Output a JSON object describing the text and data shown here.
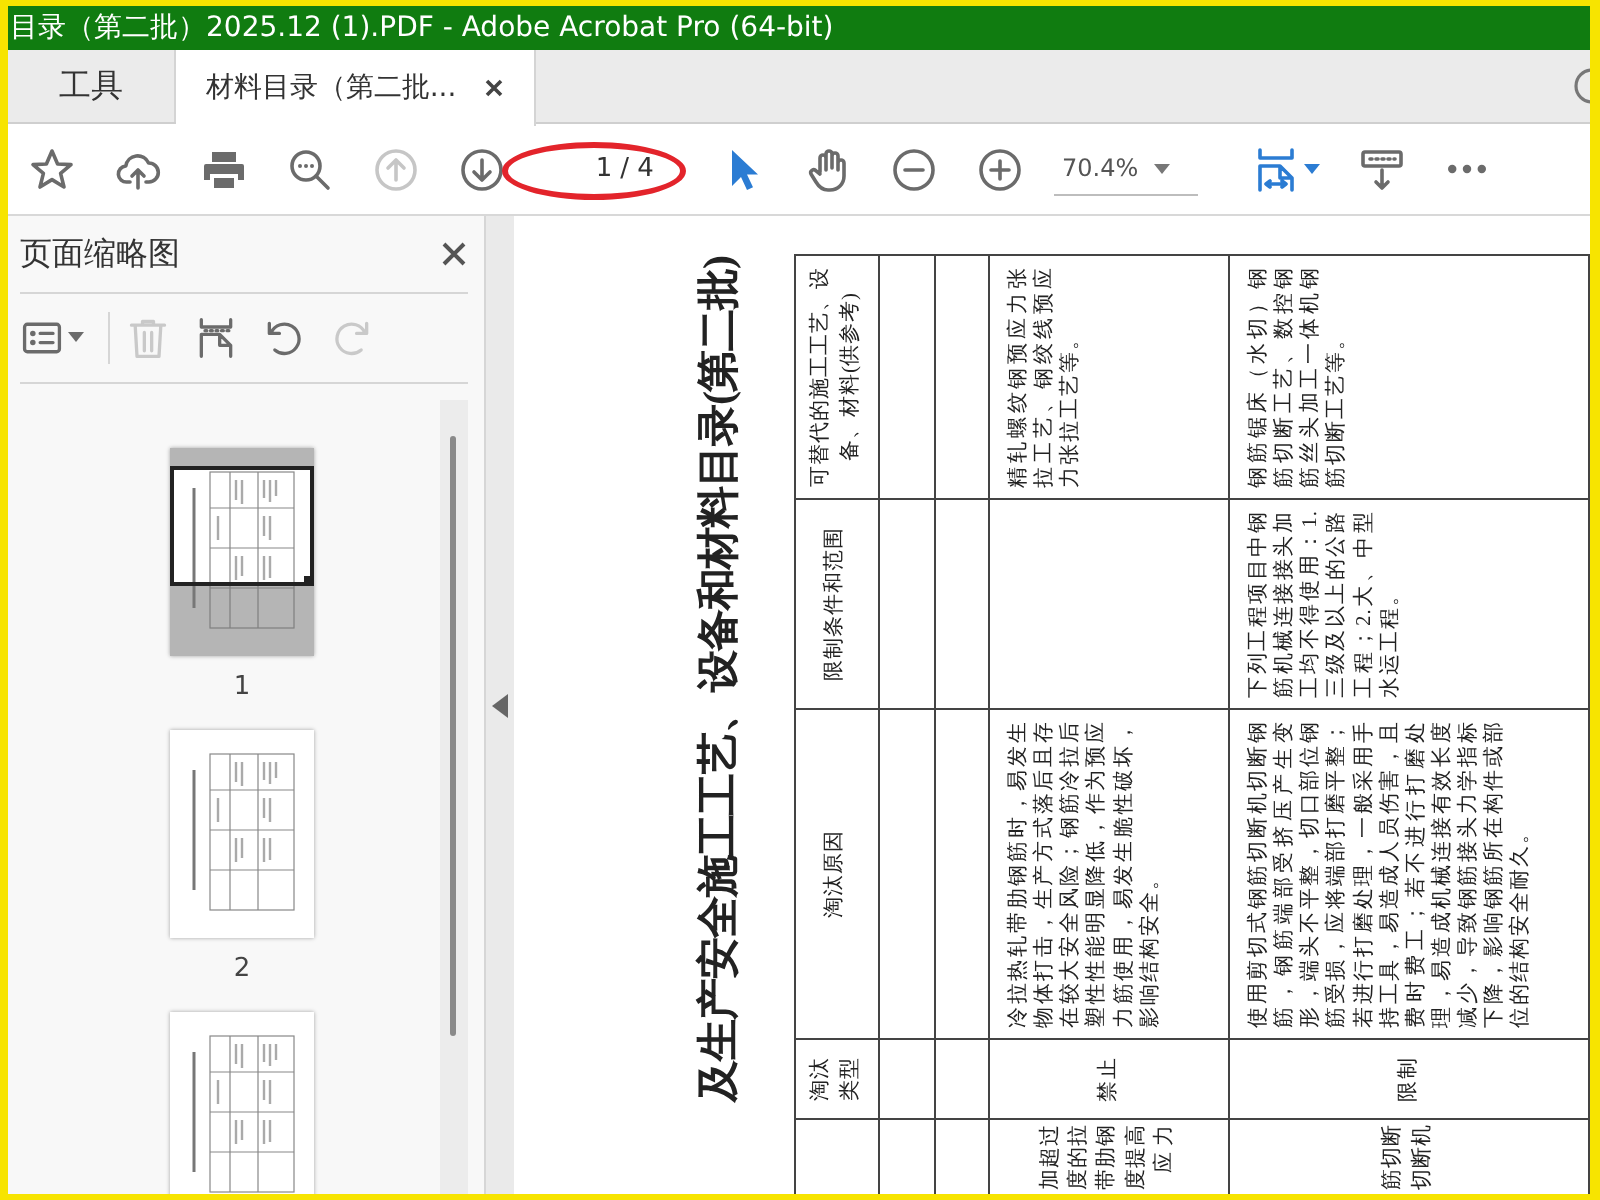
{
  "window": {
    "title": "目录（第二批）2025.12 (1).PDF - Adobe Acrobat Pro (64-bit)"
  },
  "tabs": [
    {
      "label": "工具",
      "kind": "home",
      "selected": false
    },
    {
      "label": "材料目录（第二批...",
      "kind": "document",
      "selected": true
    }
  ],
  "toolbar": [
    {
      "kind": "star",
      "disabled": false
    },
    {
      "kind": "upload",
      "disabled": false
    },
    {
      "kind": "print",
      "disabled": false
    },
    {
      "kind": "find",
      "disabled": false
    },
    {
      "kind": "prev_page",
      "disabled": true
    },
    {
      "kind": "next_page",
      "disabled": false
    },
    {
      "kind": "page_field",
      "value": "1",
      "total": "/ 4"
    },
    {
      "kind": "select",
      "disabled": false,
      "selected": true
    },
    {
      "kind": "hand",
      "disabled": false,
      "selected": false
    },
    {
      "kind": "zoom_out",
      "disabled": false
    },
    {
      "kind": "zoom_in",
      "disabled": false
    },
    {
      "kind": "zoom_field",
      "value": "70.4%"
    },
    {
      "kind": "fit",
      "disabled": false
    },
    {
      "kind": "read_mode",
      "disabled": false
    },
    {
      "kind": "more",
      "disabled": false
    }
  ],
  "thumbnail_panel": {
    "title": "页面缩略图",
    "tools": [
      {
        "kind": "options",
        "disabled": false
      },
      {
        "kind": "delete",
        "disabled": true
      },
      {
        "kind": "extract",
        "disabled": false
      },
      {
        "kind": "rotate_left",
        "disabled": false
      },
      {
        "kind": "rotate_right",
        "disabled": true
      }
    ],
    "pages": [
      {
        "label": "1",
        "selected": true
      },
      {
        "label": "2",
        "selected": false
      },
      {
        "selected": false
      }
    ]
  },
  "document": {
    "title": "及生产安全施工工艺、设备和材料目录(第二批)",
    "table": {
      "columns": {
        "type": "淘汰类型",
        "reason": "淘汰原因",
        "limits": "限制条件和范围",
        "alternative": "可替代的施工工艺、设备、材料(供参考)"
      },
      "rows": [
        {
          "column_1": [
            "加超过",
            "度的拉",
            "带肋钢",
            "度提高",
            "应 力"
          ],
          "type": "禁止",
          "reason": "冷拉热轧带肋钢筋时，易发生物体打击，生产方式落后且存在较大安全风险；钢筋冷拉后塑性性能明显降低，作为预应力筋使用，易发生脆性破坏，影响结构安全。",
          "alternative": "精轧螺纹钢预应力张拉工艺、钢绞线预应力张拉工艺等。"
        },
        {
          "column_1": [
            "筋切断",
            "切断机"
          ],
          "type": "限制",
          "reason": "使用剪切式钢筋切断机切断钢筋，钢筋端部受挤压产生变形，端头不平整，切口部位钢筋受损，应将端部打磨平整；若进行打磨处理，一般采用手持工具，易造成人员伤害，且费时费工；若不进行打磨处理，易造成机械连接有效长度减少，导致钢筋接头力学指标下降，影响钢筋所在构件或部位的结构安全耐久。",
          "limits": "下列工程项目中钢筋机械连接接头加工均不得使用：1.三级及以上的公路工程；2.大、中型水运工程。",
          "alternative": "钢筋锯床（水切）钢筋切断工艺、数控钢筋丝头加工一体机钢筋切断工艺等。"
        }
      ]
    }
  }
}
